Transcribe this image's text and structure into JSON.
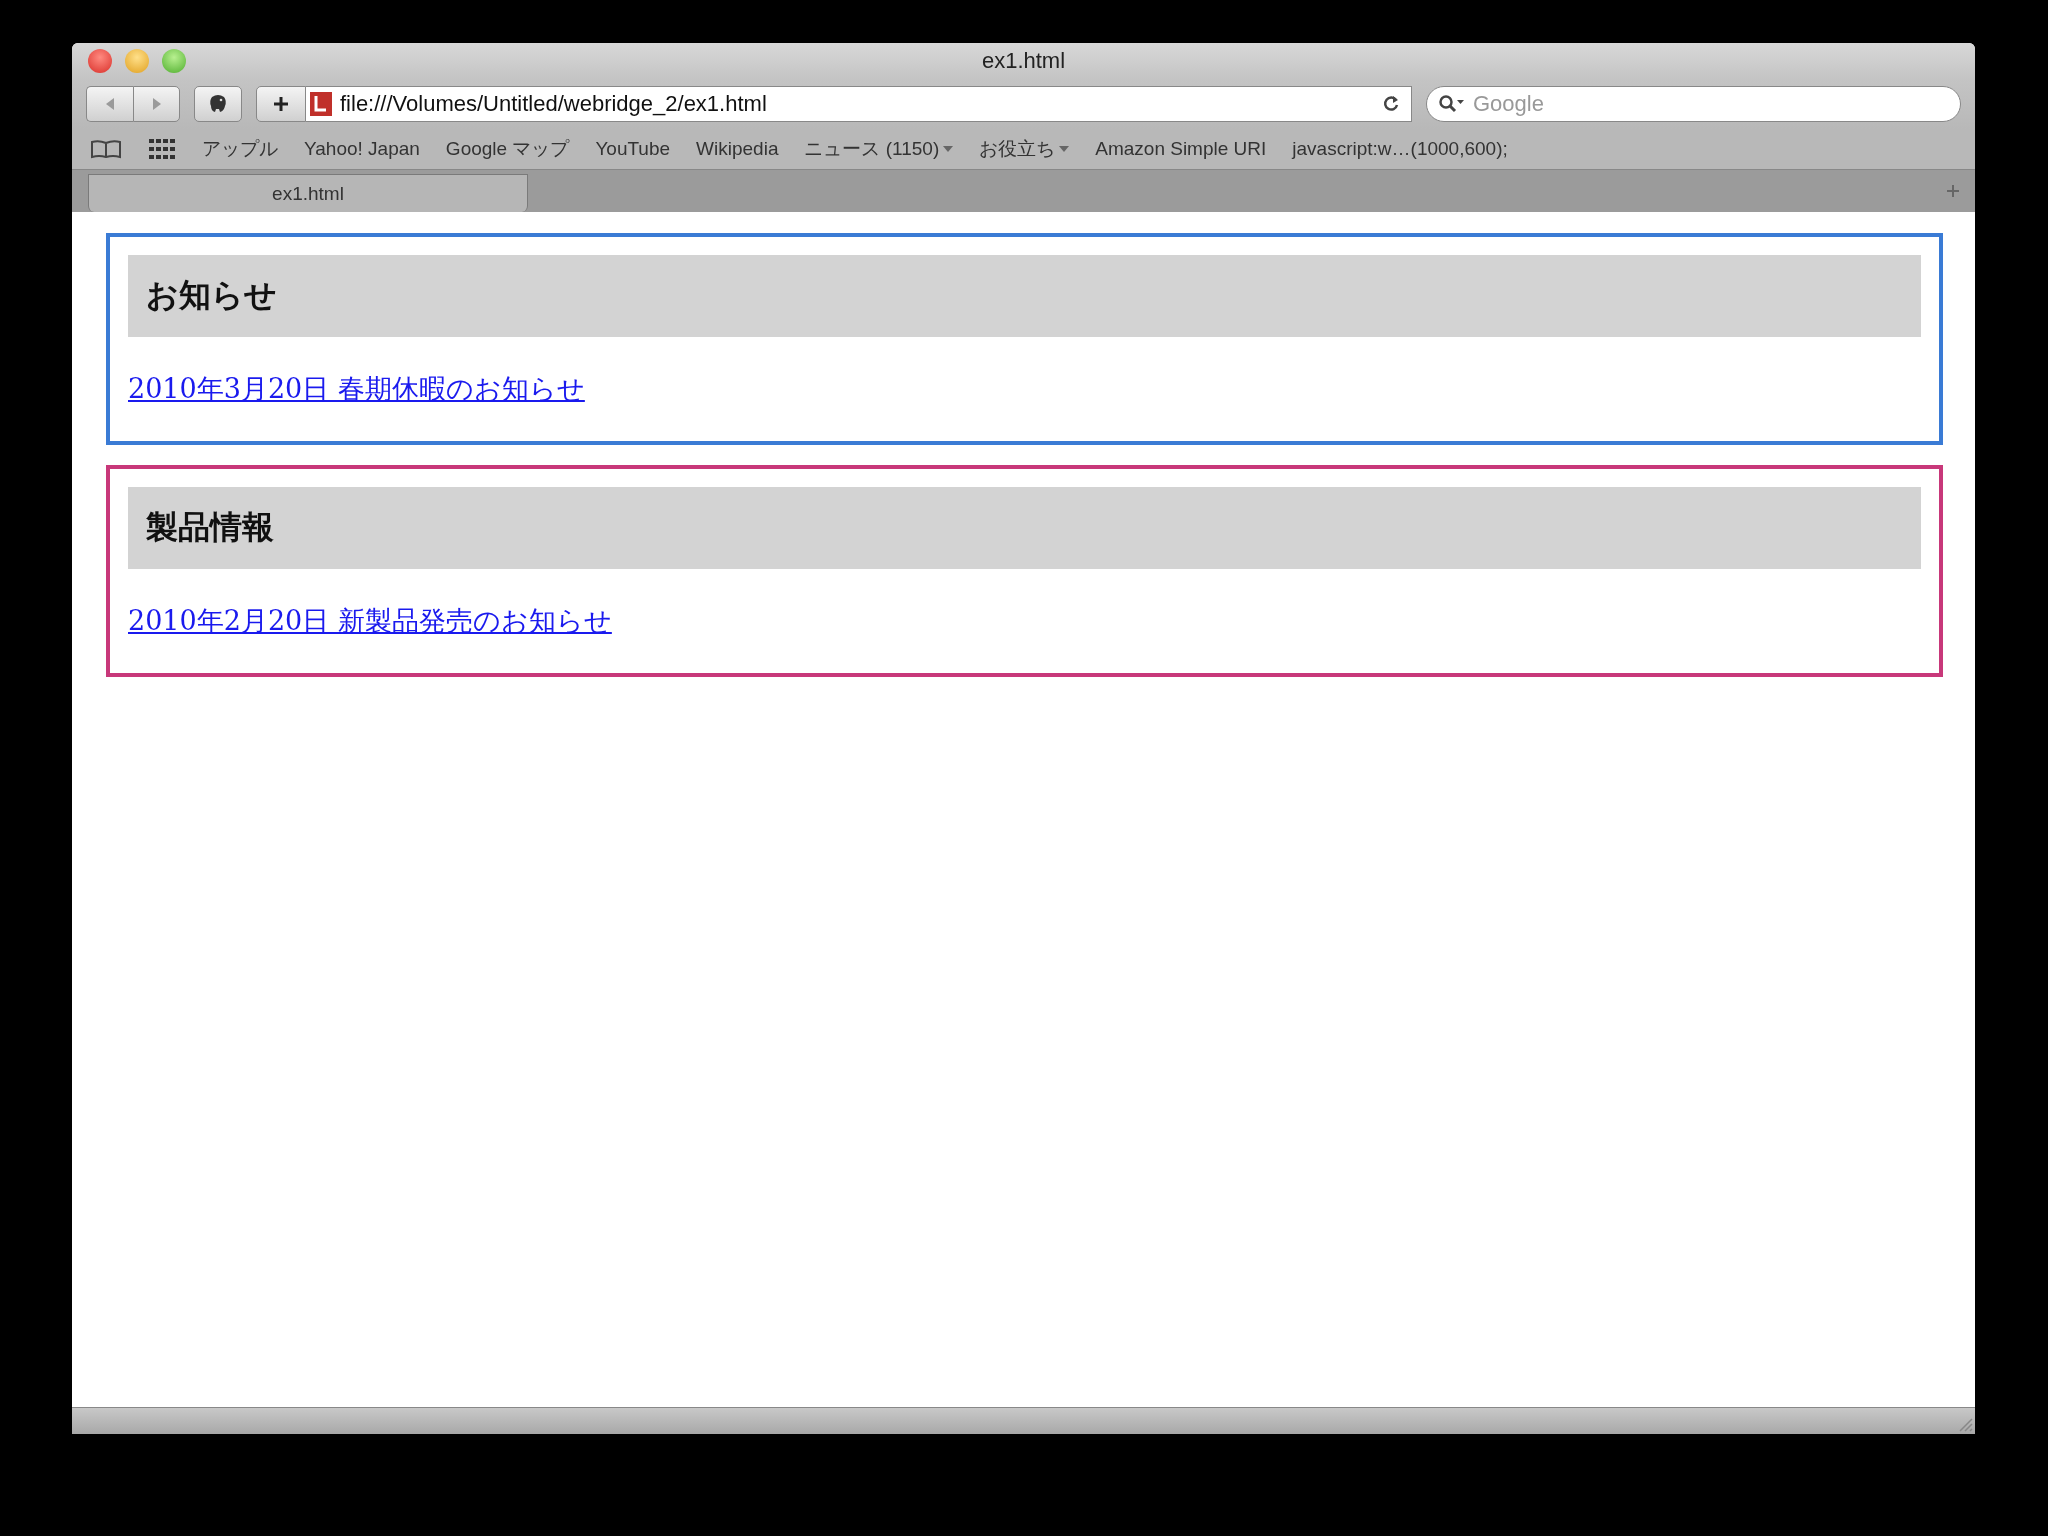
{
  "window": {
    "title": "ex1.html"
  },
  "toolbar": {
    "address": "file:///Volumes/Untitled/webridge_2/ex1.html",
    "search": {
      "placeholder": "Google"
    }
  },
  "bookmarks": [
    {
      "label": "アップル",
      "kind": "link"
    },
    {
      "label": "Yahoo! Japan",
      "kind": "link"
    },
    {
      "label": "Google マップ",
      "kind": "link"
    },
    {
      "label": "YouTube",
      "kind": "link"
    },
    {
      "label": "Wikipedia",
      "kind": "link"
    },
    {
      "label": "ニュース (1150)",
      "kind": "folder"
    },
    {
      "label": "お役立ち",
      "kind": "folder"
    },
    {
      "label": "Amazon Simple URI",
      "kind": "link"
    },
    {
      "label": "javascript:w…(1000,600);",
      "kind": "link"
    }
  ],
  "tabs": [
    {
      "label": "ex1.html",
      "selected": true
    }
  ],
  "sections": [
    {
      "heading": "お知らせ",
      "color": "#3a7bd5",
      "link": "2010年3月20日 春期休暇のお知らせ"
    },
    {
      "heading": "製品情報",
      "color": "#c8387a",
      "link": "2010年2月20日 新製品発売のお知らせ"
    }
  ]
}
